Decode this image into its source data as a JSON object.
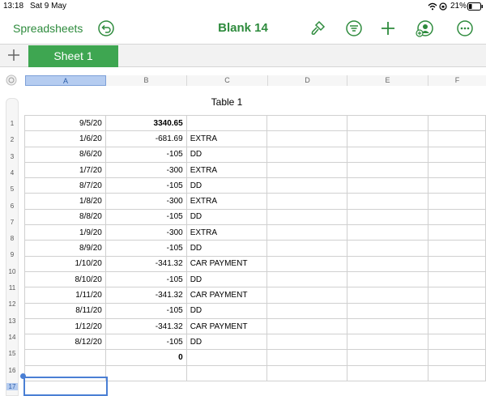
{
  "status_bar": {
    "time": "13:18",
    "date": "Sat 9 May",
    "battery": "21%"
  },
  "toolbar": {
    "back_label": "Spreadsheets",
    "title": "Blank 14",
    "accent_color": "#2e8b3d"
  },
  "tabs": {
    "sheets": [
      "Sheet 1"
    ],
    "active": "Sheet 1"
  },
  "columns": [
    "A",
    "B",
    "C",
    "D",
    "E",
    "F"
  ],
  "table": {
    "title": "Table 1",
    "rows": [
      {
        "n": "1",
        "a": "9/5/20",
        "b": "3340.65",
        "c": ""
      },
      {
        "n": "2",
        "a": "1/6/20",
        "b": "-681.69",
        "c": "EXTRA"
      },
      {
        "n": "3",
        "a": "8/6/20",
        "b": "-105",
        "c": "DD"
      },
      {
        "n": "4",
        "a": "1/7/20",
        "b": "-300",
        "c": "EXTRA"
      },
      {
        "n": "5",
        "a": "8/7/20",
        "b": "-105",
        "c": "DD"
      },
      {
        "n": "6",
        "a": "1/8/20",
        "b": "-300",
        "c": "EXTRA"
      },
      {
        "n": "7",
        "a": "8/8/20",
        "b": "-105",
        "c": "DD"
      },
      {
        "n": "8",
        "a": "1/9/20",
        "b": "-300",
        "c": "EXTRA"
      },
      {
        "n": "9",
        "a": "8/9/20",
        "b": "-105",
        "c": "DD"
      },
      {
        "n": "10",
        "a": "1/10/20",
        "b": "-341.32",
        "c": "CAR PAYMENT"
      },
      {
        "n": "11",
        "a": "8/10/20",
        "b": "-105",
        "c": "DD"
      },
      {
        "n": "12",
        "a": "1/11/20",
        "b": "-341.32",
        "c": "CAR PAYMENT"
      },
      {
        "n": "13",
        "a": "8/11/20",
        "b": "-105",
        "c": "DD"
      },
      {
        "n": "14",
        "a": "1/12/20",
        "b": "-341.32",
        "c": "CAR PAYMENT"
      },
      {
        "n": "15",
        "a": "8/12/20",
        "b": "-105",
        "c": "DD"
      },
      {
        "n": "16",
        "a": "",
        "b": "0",
        "c": ""
      },
      {
        "n": "17",
        "a": "",
        "b": "",
        "c": ""
      }
    ]
  }
}
